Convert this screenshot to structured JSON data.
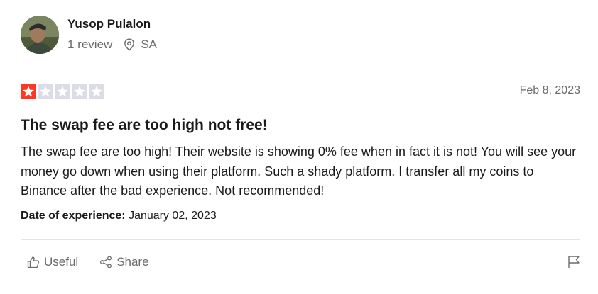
{
  "reviewer": {
    "name": "Yusop Pulalon",
    "review_count": "1 review",
    "country": "SA",
    "avatar_icon": "avatar-photo"
  },
  "review": {
    "rating": 1,
    "max_rating": 5,
    "date": "Feb 8, 2023",
    "title": "The swap fee are too high not free!",
    "body": "The swap fee are too high! Their website is showing 0% fee when in fact it is not! You will see your money go down when using their platform. Such a shady platform. I transfer all my coins to Binance after the bad experience. Not recommended!",
    "experience_label": "Date of experience:",
    "experience_date": "January 02, 2023"
  },
  "actions": {
    "useful_label": "Useful",
    "share_label": "Share",
    "useful_icon": "thumbs-up-icon",
    "share_icon": "share-icon",
    "report_icon": "flag-icon"
  },
  "colors": {
    "star_active": "#ff3722",
    "star_inactive": "#dcdce6",
    "muted_text": "#6b6b6b",
    "divider": "#e5e5dd"
  }
}
